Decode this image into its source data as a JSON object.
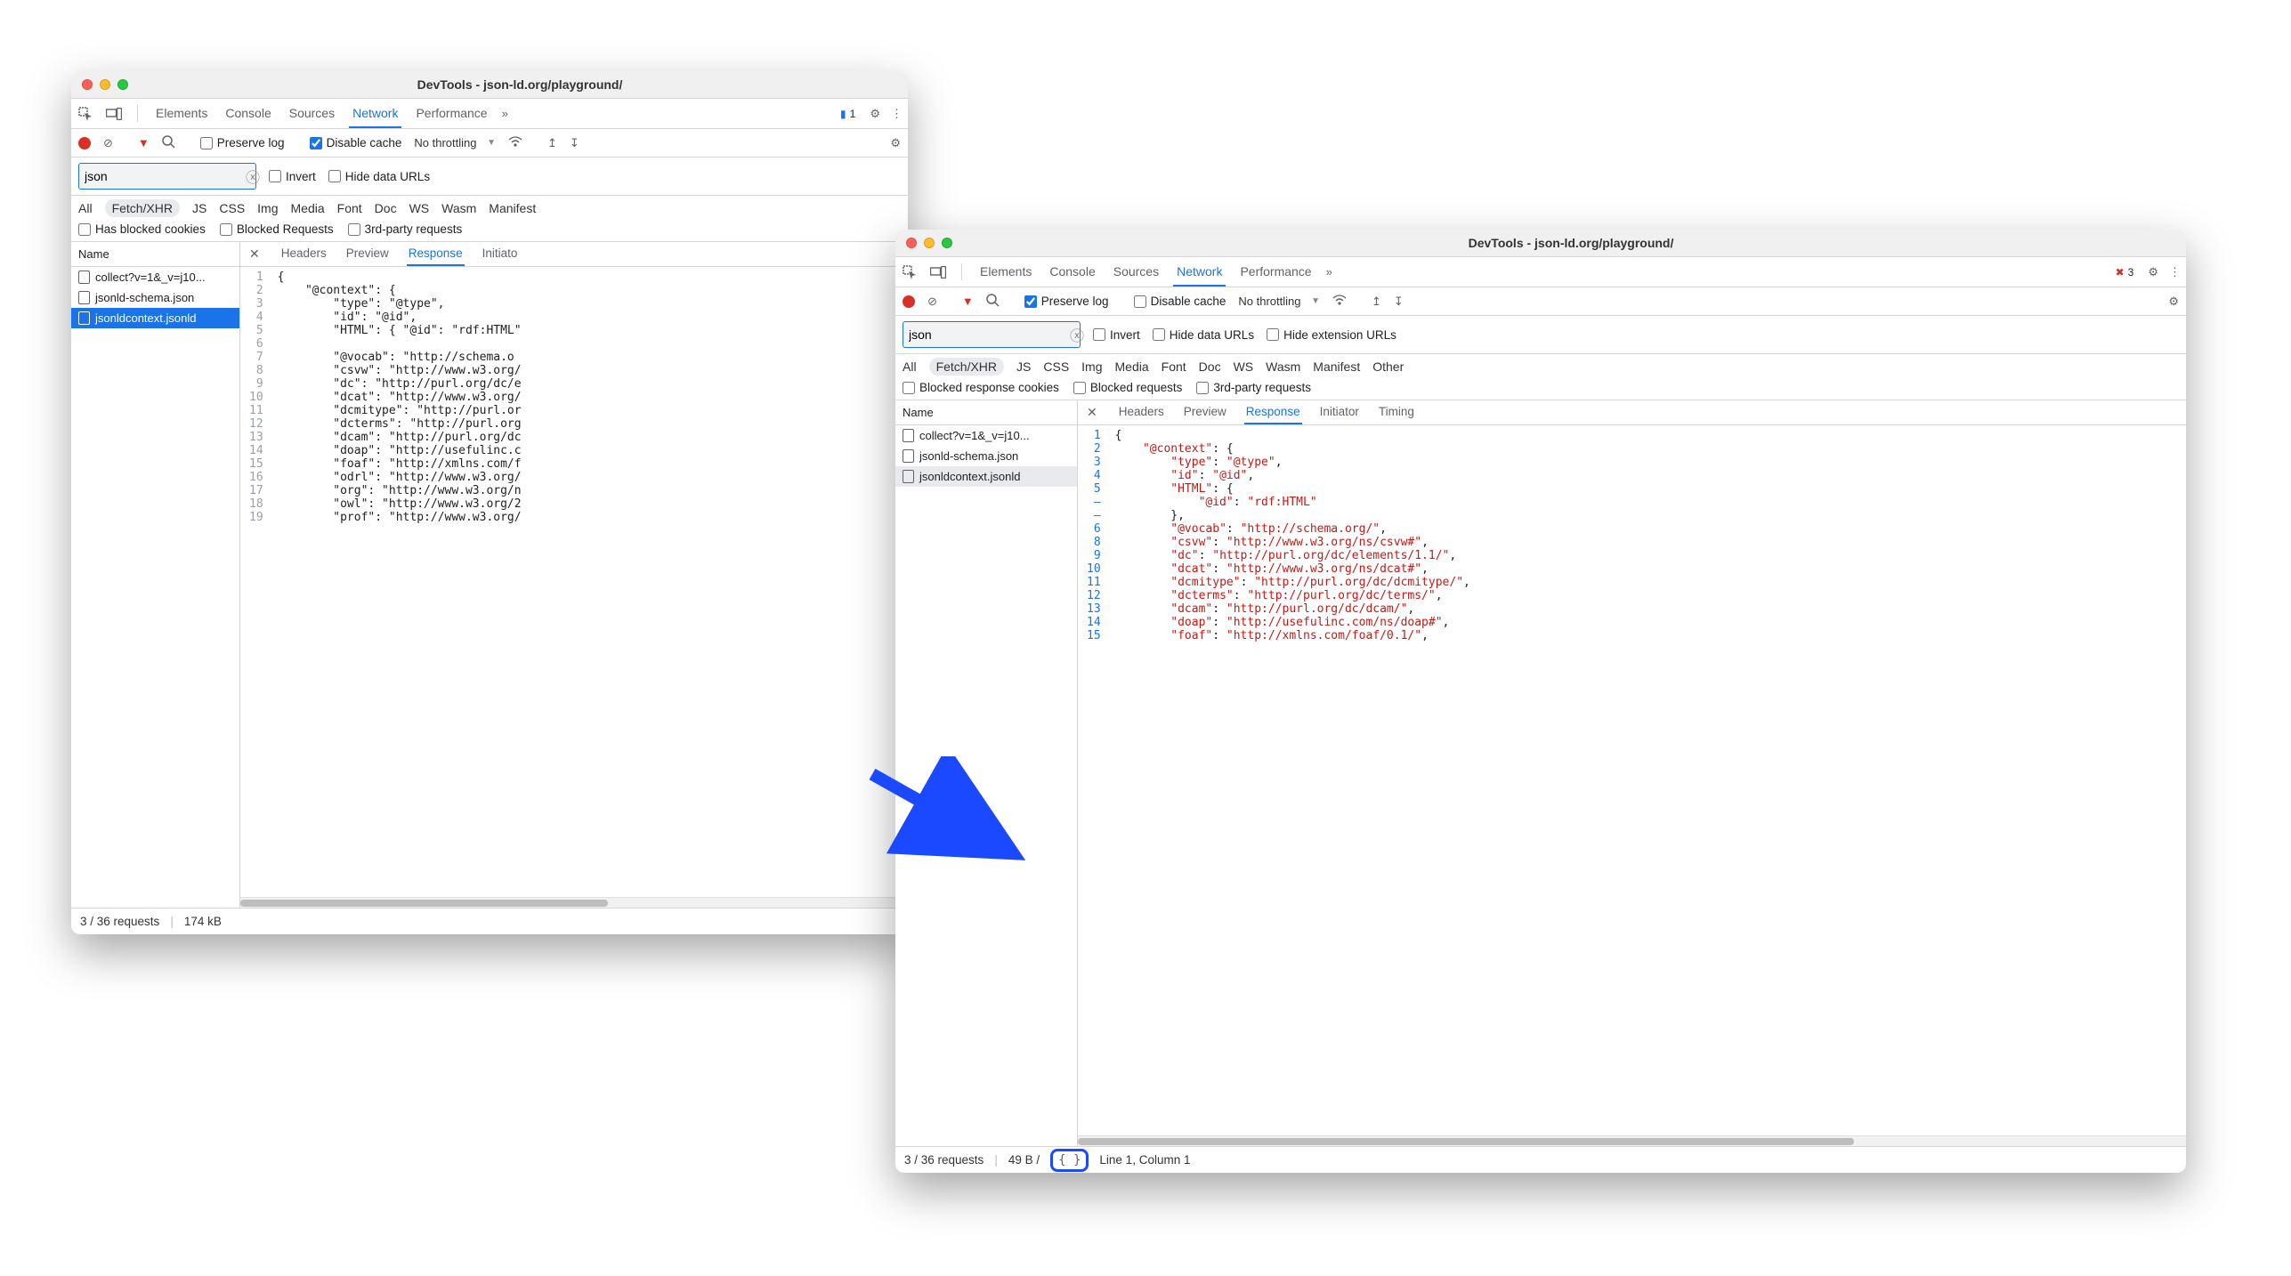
{
  "window1": {
    "title": "DevTools - json-ld.org/playground/",
    "tabs": [
      "Elements",
      "Console",
      "Sources",
      "Network",
      "Performance"
    ],
    "active_tab": "Network",
    "issues": 1,
    "preserve_log_checked": false,
    "preserve_log_label": "Preserve log",
    "disable_cache_checked": true,
    "disable_cache_label": "Disable cache",
    "throttling": "No throttling",
    "filter_value": "json",
    "invert_label": "Invert",
    "hide_data_urls_label": "Hide data URLs",
    "type_filters": [
      "All",
      "Fetch/XHR",
      "JS",
      "CSS",
      "Img",
      "Media",
      "Font",
      "Doc",
      "WS",
      "Wasm",
      "Manifest"
    ],
    "type_selected": "Fetch/XHR",
    "opt1": "Has blocked cookies",
    "opt2": "Blocked Requests",
    "opt3": "3rd-party requests",
    "name_header": "Name",
    "requests": [
      "collect?v=1&_v=j10...",
      "jsonld-schema.json",
      "jsonldcontext.jsonld"
    ],
    "selected_request_index": 2,
    "detail_tabs": [
      "Headers",
      "Preview",
      "Response",
      "Initiato"
    ],
    "detail_active": "Response",
    "gutter": "1\n2\n3\n4\n5\n6\n7\n8\n9\n10\n11\n12\n13\n14\n15\n16\n17\n18\n19",
    "code_lines": [
      "{",
      "    \"@context\": {",
      "        \"type\": \"@type\",",
      "        \"id\": \"@id\",",
      "        \"HTML\": { \"@id\": \"rdf:HTML\"",
      "",
      "        \"@vocab\": \"http://schema.o",
      "        \"csvw\": \"http://www.w3.org/",
      "        \"dc\": \"http://purl.org/dc/e",
      "        \"dcat\": \"http://www.w3.org/",
      "        \"dcmitype\": \"http://purl.or",
      "        \"dcterms\": \"http://purl.org",
      "        \"dcam\": \"http://purl.org/dc",
      "        \"doap\": \"http://usefulinc.c",
      "        \"foaf\": \"http://xmlns.com/f",
      "        \"odrl\": \"http://www.w3.org/",
      "        \"org\": \"http://www.w3.org/n",
      "        \"owl\": \"http://www.w3.org/2",
      "        \"prof\": \"http://www.w3.org/"
    ],
    "status_requests": "3 / 36 requests",
    "status_size": "174 kB"
  },
  "window2": {
    "title": "DevTools - json-ld.org/playground/",
    "tabs": [
      "Elements",
      "Console",
      "Sources",
      "Network",
      "Performance"
    ],
    "active_tab": "Network",
    "errors": 3,
    "preserve_log_checked": true,
    "preserve_log_label": "Preserve log",
    "disable_cache_checked": false,
    "disable_cache_label": "Disable cache",
    "throttling": "No throttling",
    "filter_value": "json",
    "invert_label": "Invert",
    "hide_data_urls_label": "Hide data URLs",
    "hide_ext_label": "Hide extension URLs",
    "type_filters": [
      "All",
      "Fetch/XHR",
      "JS",
      "CSS",
      "Img",
      "Media",
      "Font",
      "Doc",
      "WS",
      "Wasm",
      "Manifest",
      "Other"
    ],
    "type_selected": "Fetch/XHR",
    "opt1": "Blocked response cookies",
    "opt2": "Blocked requests",
    "opt3": "3rd-party requests",
    "name_header": "Name",
    "requests": [
      "collect?v=1&_v=j10...",
      "jsonld-schema.json",
      "jsonldcontext.jsonld"
    ],
    "hovered_request_index": 2,
    "detail_tabs": [
      "Headers",
      "Preview",
      "Response",
      "Initiator",
      "Timing"
    ],
    "detail_active": "Response",
    "gutter": "1\n2\n3\n4\n5\n–\n–\n6\n8\n9\n10\n11\n12\n13\n14\n15",
    "status_requests": "3 / 36 requests",
    "status_size": "49 B /",
    "status_cursor": "Line 1, Column 1",
    "pretty_label": "{ }"
  },
  "chart_data": null
}
